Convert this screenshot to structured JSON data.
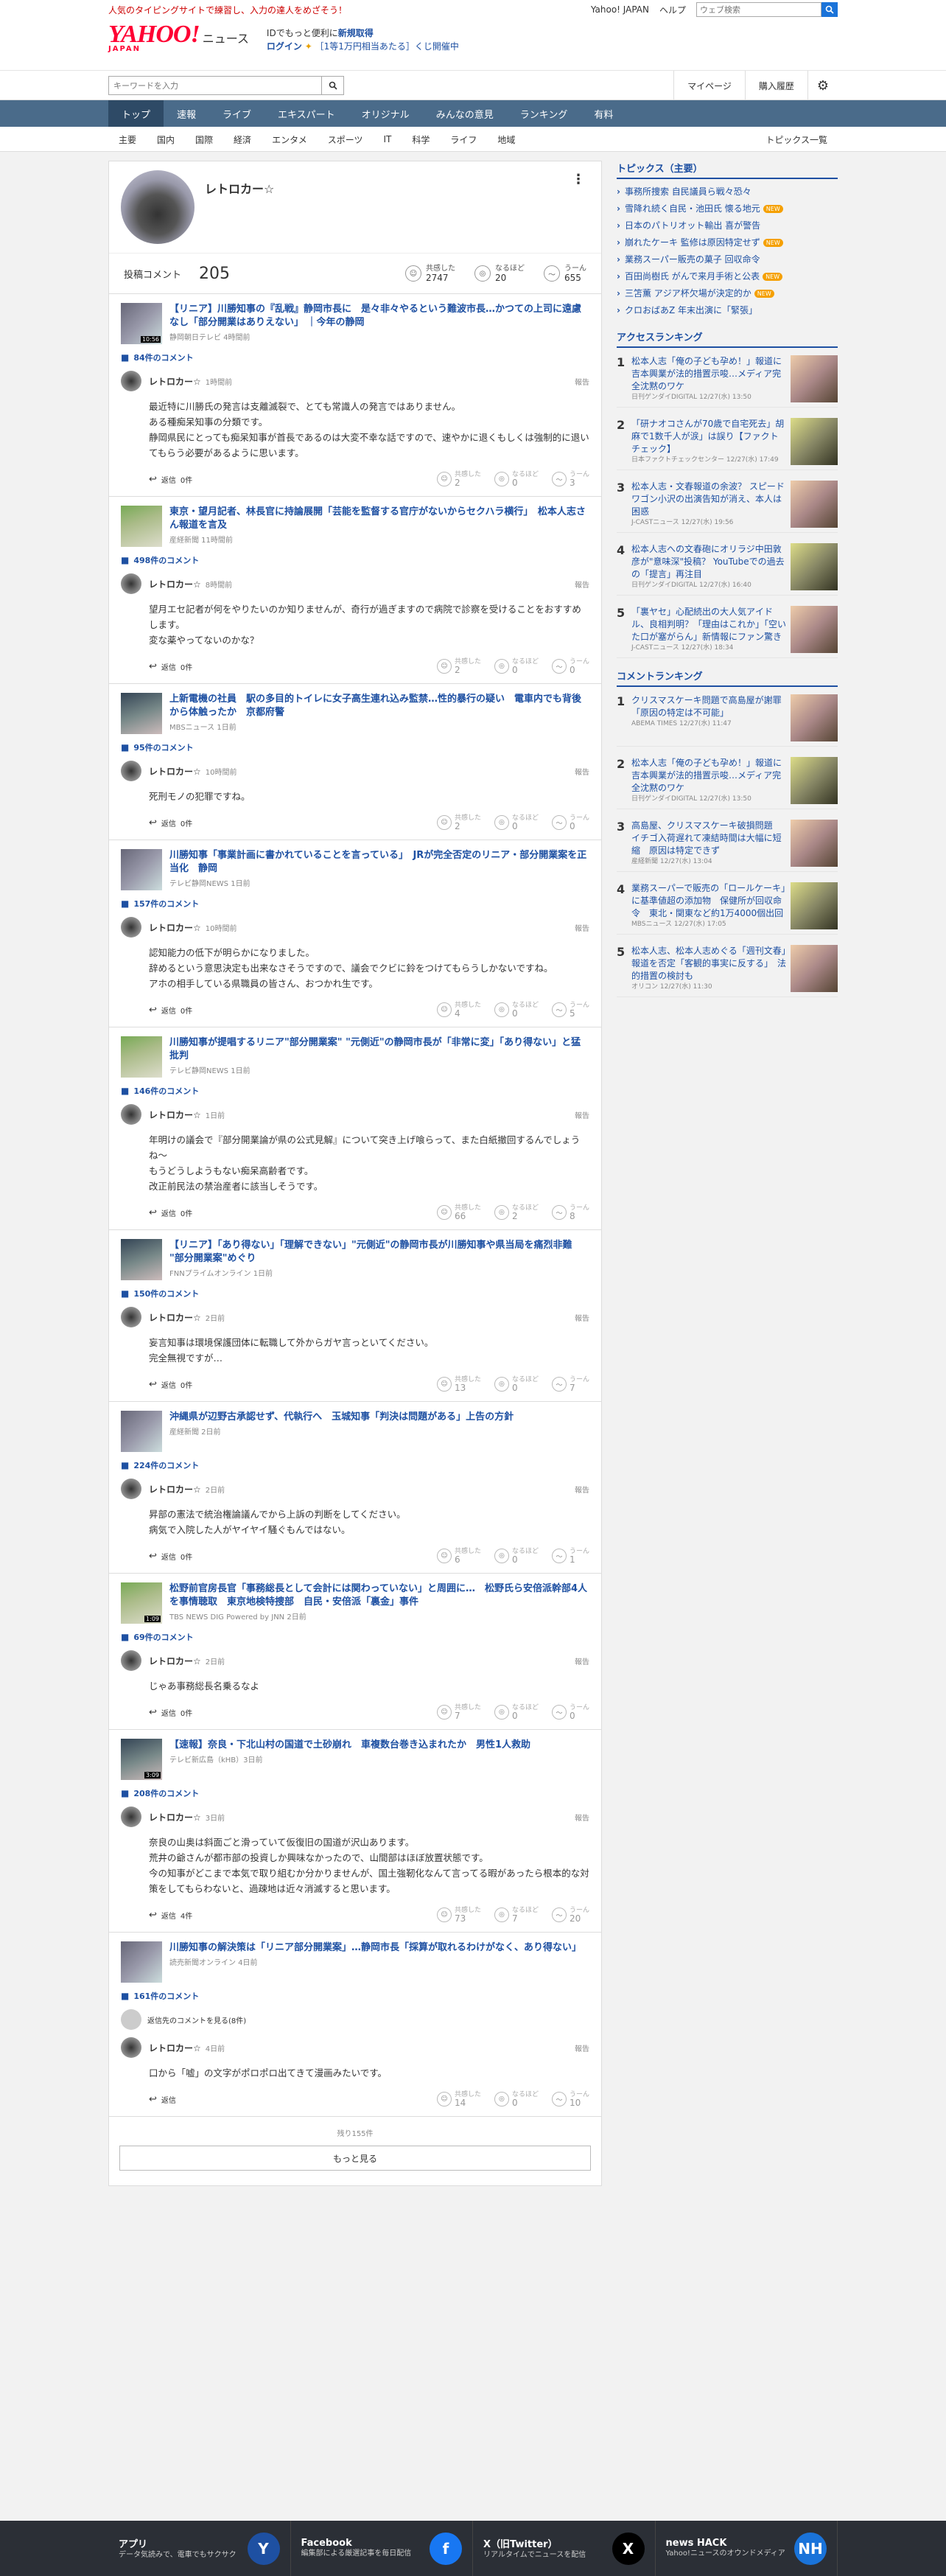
{
  "top": {
    "promo": "人気のタイピングサイトで練習し、入力の達人をめざそう！",
    "yj": "Yahoo! JAPAN",
    "help": "ヘルプ",
    "search_placeholder": "ウェブ検索"
  },
  "header": {
    "logo": "YAHOO!",
    "logo_sub": "JAPAN",
    "news": "ニュース",
    "msg1a": "IDでもっと便利に",
    "msg1b": "新規取得",
    "login": "ログイン",
    "lottery": "［1等1万円相当あたる］くじ開催中"
  },
  "bar2": {
    "placeholder": "キーワードを入力",
    "mypage": "マイページ",
    "history": "購入履歴"
  },
  "gnav": [
    "トップ",
    "速報",
    "ライブ",
    "エキスパート",
    "オリジナル",
    "みんなの意見",
    "ランキング",
    "有料"
  ],
  "subnav": [
    "主要",
    "国内",
    "国際",
    "経済",
    "エンタメ",
    "スポーツ",
    "IT",
    "科学",
    "ライフ",
    "地域"
  ],
  "subnav_last": "トピックス一覧",
  "profile": {
    "name": "レトロカー☆",
    "posts_label": "投稿コメント",
    "posts": "205",
    "agree_l": "共感した",
    "agree": "2747",
    "naru_l": "なるほど",
    "naru": "20",
    "un_l": "うーん",
    "un": "655"
  },
  "common": {
    "report": "報告",
    "reply": "返信",
    "agree": "共感した",
    "naru": "なるほど",
    "un": "うーん"
  },
  "entries": [
    {
      "title": "【リニア】川勝知事の『乱戦』静岡市長に　是々非々やるという難波市長…かつての上司に遠慮なし「部分開業はありえない」 ｜今年の静岡",
      "src": "静岡朝日テレビ 4時間前",
      "dur": "10:56",
      "count": "84件のコメント",
      "time": "1時間前",
      "body": "最近特に川勝氏の発言は支離滅裂で、とても常識人の発言ではありません。\nある種痴呆知事の分類です。\n静岡県民にとっても痴呆知事が首長であるのは大変不幸な話ですので、速やかに退くもしくは強制的に退いてもらう必要があるように思います。",
      "reply": "0件",
      "a": "2",
      "n": "0",
      "u": "3"
    },
    {
      "title": "東京・望月記者、林長官に持論展開「芸能を監督する官庁がないからセクハラ横行」　松本人志さん報道を言及",
      "src": "産経新聞 11時間前",
      "count": "498件のコメント",
      "time": "8時間前",
      "body": "望月エセ記者が何をやりたいのか知りませんが、奇行が過ぎますので病院で診察を受けることをおすすめします。\n変な薬やってないのかな？",
      "reply": "0件",
      "a": "2",
      "n": "0",
      "u": "0"
    },
    {
      "title": "上新電機の社員　駅の多目的トイレに女子高生連れ込み監禁…性的暴行の疑い　電車内でも背後から体触ったか　京都府警",
      "src": "MBSニュース 1日前",
      "count": "95件のコメント",
      "time": "10時間前",
      "body": "死刑モノの犯罪ですね。",
      "reply": "0件",
      "a": "2",
      "n": "0",
      "u": "0"
    },
    {
      "title": "川勝知事「事業計画に書かれていることを言っている」　JRが完全否定のリニア・部分開業案を正当化　静岡",
      "src": "テレビ静岡NEWS 1日前",
      "count": "157件のコメント",
      "time": "10時間前",
      "body": "認知能力の低下が明らかになりました。\n辞めるという意思決定も出来なさそうですので、議会でクビに鈴をつけてもらうしかないですね。\nアホの相手している県職員の皆さん、おつかれ生です。",
      "reply": "0件",
      "a": "4",
      "n": "0",
      "u": "5"
    },
    {
      "title": "川勝知事が提唱するリニア\"部分開業案\" \"元側近\"の静岡市長が「非常に変」「あり得ない」と猛批判",
      "src": "テレビ静岡NEWS 1日前",
      "count": "146件のコメント",
      "time": "1日前",
      "body": "年明けの議会で『部分開業論が県の公式見解』について突き上げ喰らって、また白紙撤回するんでしょうね〜\nもうどうしようもない痴呆高齢者です。\n改正前民法の禁治産者に該当しそうです。",
      "reply": "0件",
      "a": "66",
      "n": "2",
      "u": "8"
    },
    {
      "title": "【リニア】「あり得ない」「理解できない」\"元側近\"の静岡市長が川勝知事や県当局を痛烈非難 \"部分開業案\"めぐり",
      "src": "FNNプライムオンライン 1日前",
      "count": "150件のコメント",
      "time": "2日前",
      "body": "妄言知事は環境保護団体に転職して外からガヤ言っといてください。\n完全無視ですが…",
      "reply": "0件",
      "a": "13",
      "n": "0",
      "u": "7"
    },
    {
      "title": "沖縄県が辺野古承認せず、代執行へ　玉城知事「判決は問題がある」上告の方針",
      "src": "産経新聞 2日前",
      "count": "224件のコメント",
      "time": "2日前",
      "body": "昇部の憲法で統治権論議んでから上訴の判断をしてください。\n病気で入院した人がヤイヤイ騒ぐもんではない。",
      "reply": "0件",
      "a": "6",
      "n": "0",
      "u": "1"
    },
    {
      "title": "松野前官房長官「事務総長として会計には関わっていない」と周囲に…　松野氏ら安倍派幹部4人を事情聴取　東京地検特捜部　自民・安倍派「裏金」事件",
      "src": "TBS NEWS DIG Powered by JNN 2日前",
      "dur": "1:09",
      "count": "69件のコメント",
      "time": "2日前",
      "body": "じゃあ事務総長名乗るなよ",
      "reply": "0件",
      "a": "7",
      "n": "0",
      "u": "0"
    },
    {
      "title": "【速報】奈良・下北山村の国道で土砂崩れ　車複数台巻き込まれたか　男性1人救助",
      "src": "テレビ新広島（kHB）3日前",
      "dur": "3:09",
      "count": "208件のコメント",
      "time": "3日前",
      "body": "奈良の山奥は斜面ごと滑っていて仮復旧の国道が沢山あります。\n荒井の爺さんが都市部の投資しか興味なかったので、山間部はほぼ放置状態です。\n今の知事がどこまで本気で取り組むか分かりませんが、国土強靭化なんて言ってる暇があったら根本的な対策をしてもらわないと、過疎地は近々消滅すると思います。",
      "reply": "4件",
      "a": "73",
      "n": "7",
      "u": "20"
    },
    {
      "title": "川勝知事の解決策は「リニア部分開業案」…静岡市長「採算が取れるわけがなく、あり得ない」",
      "src": "読売新聞オンライン 4日前",
      "count": "161件のコメント",
      "alt": "返信先のコメントを見る(8件)",
      "time": "4日前",
      "body": "口から「嘘」の文字がポロポロ出てきて漫画みたいです。",
      "reply": "",
      "a": "14",
      "n": "0",
      "u": "10"
    }
  ],
  "rest": "残り155件",
  "more": "もっと見る",
  "topics_h": "トピックス（主要）",
  "topics": [
    {
      "t": "事務所捜索 自民議員ら戦々恐々",
      "new": ""
    },
    {
      "t": "雪降れ続く自民・池田氏 懐る地元",
      "new": "NEW"
    },
    {
      "t": "日本のパトリオット輸出 喜が警告",
      "new": ""
    },
    {
      "t": "崩れたケーキ 監修は原因特定せず",
      "new": "NEW"
    },
    {
      "t": "業務スーパー販売の菓子 回収命令",
      "new": ""
    },
    {
      "t": "百田尚樹氏 がんで来月手術と公表",
      "new": "NEW"
    },
    {
      "t": "三笘薫 アジア杯欠場が決定的か",
      "new": "NEW"
    },
    {
      "t": "クロおばあZ 年末出演に「緊張」",
      "new": ""
    }
  ],
  "access_h": "アクセスランキング",
  "access": [
    {
      "t": "松本人志「俺の子ども孕め！」報道に吉本興業が法的措置示唆…メディア完全沈黙のワケ",
      "s": "日刊ゲンダイDIGITAL 12/27(水) 13:50"
    },
    {
      "t": "「研ナオコさんが70歳で自宅死去」胡麻で1数千人が涙」は誤り【ファクトチェック】",
      "s": "日本ファクトチェックセンター 12/27(水) 17:49"
    },
    {
      "t": "松本人志・文春報道の余波？ スピードワゴン小沢の出演告知が消え、本人は困惑",
      "s": "J-CASTニュース 12/27(水) 19:56"
    },
    {
      "t": "松本人志への文春砲にオリラジ中田敦彦が\"意味深\"投稿？ YouTubeでの過去の「提言」再注目",
      "s": "日刊ゲンダイDIGITAL 12/27(水) 16:40"
    },
    {
      "t": "「裏ヤセ」心配続出の大人気アイドル、良相判明？「理由はこれか」「空いた口が塞がらん」新情報にファン驚き",
      "s": "J-CASTニュース 12/27(水) 18:34"
    }
  ],
  "crank_h": "コメントランキング",
  "crank": [
    {
      "t": "クリスマスケーキ問題で高島屋が謝罪「原因の特定は不可能」",
      "s": "ABEMA TIMES 12/27(水) 11:47"
    },
    {
      "t": "松本人志「俺の子ども孕め！」報道に吉本興業が法的措置示唆…メディア完全沈黙のワケ",
      "s": "日刊ゲンダイDIGITAL 12/27(水) 13:50"
    },
    {
      "t": "高島屋、クリスマスケーキ破損問題　イチゴ入荷遅れて凍結時間は大幅に短縮　原因は特定できず",
      "s": "産経新聞 12/27(水) 13:04"
    },
    {
      "t": "業務スーパーで販売の「ロールケーキ」に基準値超の添加物　保健所が回収命令　東北・関東など約1万4000個出回",
      "s": "MBSニュース 12/27(水) 17:05"
    },
    {
      "t": "松本人志、松本人志めぐる「週刊文春」報道を否定「客観的事実に反する」　法的措置の検討も",
      "s": "オリコン 12/27(水) 11:30"
    }
  ],
  "footer": [
    {
      "h": "アプリ",
      "s": "データ気読みで、電車でもサクサク",
      "icon": "Y"
    },
    {
      "h": "Facebook",
      "s": "編集部による厳選記事を毎日配信",
      "icon": "f"
    },
    {
      "h": "X（旧Twitter）",
      "s": "リアルタイムでニュースを配信",
      "icon": "X"
    },
    {
      "h": "news HACK",
      "s": "Yahoo!ニュースのオウンドメディア",
      "icon": "NH"
    }
  ]
}
